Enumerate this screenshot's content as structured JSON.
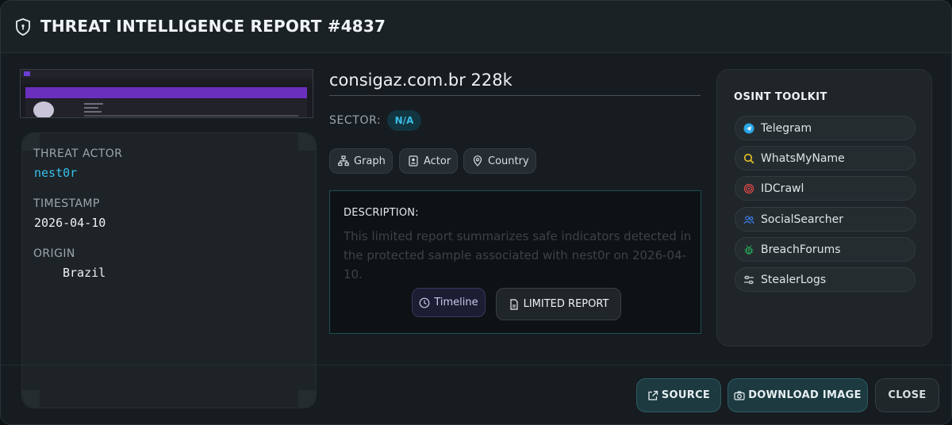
{
  "header": {
    "title": "THREAT INTELLIGENCE REPORT #4837"
  },
  "meta": {
    "actor_label": "THREAT ACTOR",
    "actor_value": "nest0r",
    "timestamp_label": "TIMESTAMP",
    "timestamp_value": "2026-04-10",
    "origin_label": "ORIGIN",
    "origin_value": "Brazil"
  },
  "site": {
    "title": "consigaz.com.br 228k",
    "sector_label": "SECTOR:",
    "sector_value": "N/A"
  },
  "pills": [
    {
      "label": "Graph",
      "icon": "graph-icon"
    },
    {
      "label": "Actor",
      "icon": "actor-icon"
    },
    {
      "label": "Country",
      "icon": "location-pin-icon"
    }
  ],
  "description": {
    "label": "DESCRIPTION:",
    "text": "This limited report summarizes safe indicators detected in the protected sample associated with nest0r on 2026-04-10.",
    "timeline_label": "Timeline",
    "limited_label": "LIMITED REPORT"
  },
  "osint": {
    "title": "OSINT TOOLKIT",
    "items": [
      {
        "label": "Telegram",
        "icon": "telegram-icon",
        "color": "#2aa7e6"
      },
      {
        "label": "WhatsMyName",
        "icon": "search-icon",
        "color": "#e6c12a"
      },
      {
        "label": "IDCrawl",
        "icon": "fingerprint-icon",
        "color": "#e04848"
      },
      {
        "label": "SocialSearcher",
        "icon": "users-icon",
        "color": "#3d7ff0"
      },
      {
        "label": "BreachForums",
        "icon": "bug-icon",
        "color": "#27b35a"
      },
      {
        "label": "StealerLogs",
        "icon": "sliders-icon",
        "color": "#c9ced2"
      }
    ]
  },
  "footer": {
    "source_label": "SOURCE",
    "download_label": "DOWNLOAD IMAGE",
    "close_label": "CLOSE"
  }
}
